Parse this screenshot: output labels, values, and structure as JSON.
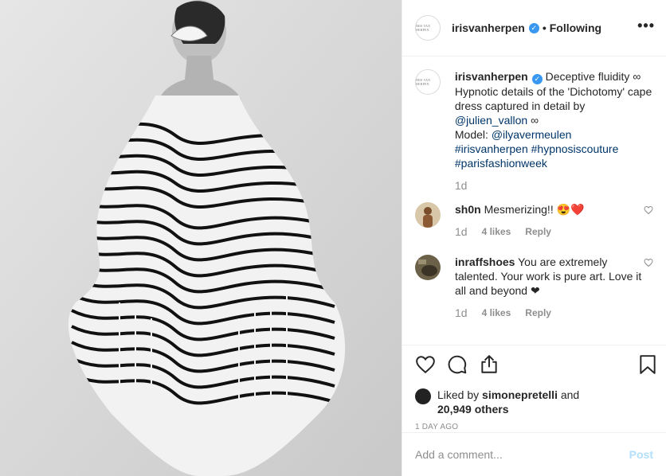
{
  "post": {
    "username": "irisvanherpen",
    "logo_text": "IRIS VAN HERPEN",
    "following_label": "Following",
    "more_label": "•••",
    "caption": {
      "username": "irisvanherpen",
      "text_line1": "Deceptive fluidity ∞ Hypnotic details of the 'Dichotomy' cape dress captured in detail by",
      "mention_photographer": "@julien_vallon",
      "infinity": "∞",
      "model_label": "Model:",
      "mention_model": "@ilyavermeulen",
      "hashtag1": "#irisvanherpen",
      "hashtag2": "#hypnosiscouture",
      "hashtag3": "#parisfashionweek",
      "time": "1d"
    },
    "comments": [
      {
        "username": "sh0n",
        "text": "Mesmerizing!! 😍❤️",
        "time": "1d",
        "likes": "4 likes",
        "reply": "Reply"
      },
      {
        "username": "inraffshoes",
        "text": "You are extremely talented. Your work is pure art. Love it all and beyond ❤",
        "time": "1d",
        "likes": "4 likes",
        "reply": "Reply"
      }
    ],
    "liked_by_prefix": "Liked by",
    "liked_by_user": "simonepretelli",
    "liked_by_and": "and",
    "liked_by_others": "20,949 others",
    "age": "1 DAY AGO",
    "add_comment_placeholder": "Add a comment...",
    "post_button": "Post"
  },
  "colors": {
    "verified": "#3897f0",
    "link": "#003569",
    "post_button": "#b2dffc",
    "muted": "#8e8e8e"
  },
  "icons": {
    "like": "heart-icon",
    "comment": "comment-icon",
    "share": "share-icon",
    "save": "bookmark-icon",
    "more": "more-options-icon"
  }
}
